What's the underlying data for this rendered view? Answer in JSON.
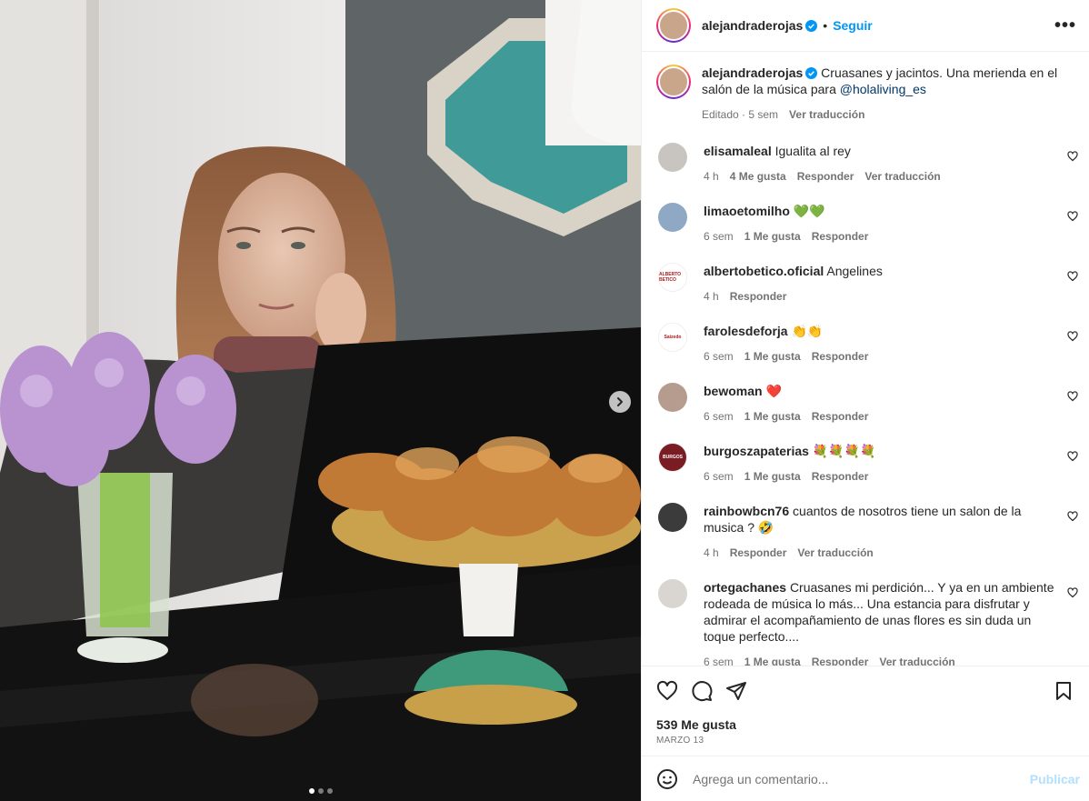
{
  "post": {
    "username": "alejandraderojas",
    "follow_label": "Seguir",
    "separator": "•",
    "more_label": "•••",
    "caption_text": "Cruasanes y jacintos. Una merienda en el salón de la música para",
    "caption_mention": "@holaliving_es",
    "caption_edited": "Editado · 5 sem",
    "caption_translate": "Ver traducción",
    "likes": "539 Me gusta",
    "date": "MARZO 13",
    "comment_placeholder": "Agrega un comentario...",
    "publish_label": "Publicar"
  },
  "media": {
    "total_slides": 3,
    "current_slide": 1
  },
  "comments": [
    {
      "username": "elisamaleal",
      "text": "Igualita al rey",
      "time": "4 h",
      "likes": "4 Me gusta",
      "reply": "Responder",
      "translate": "Ver traducción",
      "avatar_color": "#c8c4c0"
    },
    {
      "username": "limaoetomilho",
      "text": "💚💚",
      "time": "6 sem",
      "likes": "1 Me gusta",
      "reply": "Responder",
      "translate": "",
      "avatar_color": "#8fa9c4"
    },
    {
      "username": "albertobetico.oficial",
      "text": "Angelines",
      "time": "4 h",
      "likes": "",
      "reply": "Responder",
      "translate": "",
      "avatar_color": "#ffffff",
      "avatar_text": "ALBERTO BETICO"
    },
    {
      "username": "farolesdeforja",
      "text": "👏👏",
      "time": "6 sem",
      "likes": "1 Me gusta",
      "reply": "Responder",
      "translate": "",
      "avatar_color": "#ffffff",
      "avatar_text": "Saizedo"
    },
    {
      "username": "bewoman",
      "text": "❤️",
      "time": "6 sem",
      "likes": "1 Me gusta",
      "reply": "Responder",
      "translate": "",
      "avatar_color": "#b59c8e"
    },
    {
      "username": "burgoszapaterias",
      "text": "💐💐💐💐",
      "time": "6 sem",
      "likes": "1 Me gusta",
      "reply": "Responder",
      "translate": "",
      "avatar_color": "#7a1c24",
      "avatar_text": "BURGOS"
    },
    {
      "username": "rainbowbcn76",
      "text": "cuantos de nosotros tiene un salon de la musica ? 🤣",
      "time": "4 h",
      "likes": "",
      "reply": "Responder",
      "translate": "Ver traducción",
      "avatar_color": "#3b3b3b"
    },
    {
      "username": "ortegachanes",
      "text": "Cruasanes mi perdición... Y ya en un ambiente rodeada de música lo más... Una estancia para disfrutar y admirar el acompañamiento de unas flores es sin duda un toque perfecto....",
      "time": "6 sem",
      "likes": "1 Me gusta",
      "reply": "Responder",
      "translate": "Ver traducción",
      "avatar_color": "#d9d6d2"
    }
  ],
  "colors": {
    "accent": "#0095f6",
    "muted": "#737373",
    "publish_disabled": "#b2dffc",
    "verified": "#0095f6"
  },
  "icons": [
    "verified-badge-icon",
    "more-options-icon",
    "heart-icon",
    "comment-icon",
    "share-icon",
    "save-icon",
    "emoji-icon",
    "next-arrow-icon"
  ]
}
